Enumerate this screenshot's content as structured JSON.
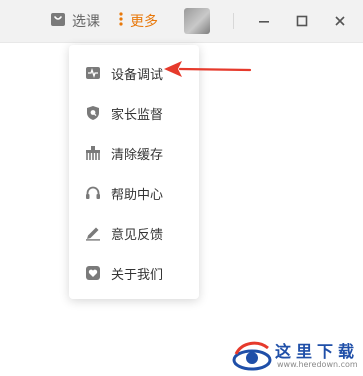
{
  "header": {
    "course_label": "选课",
    "more_label": "更多"
  },
  "menu": {
    "items": [
      {
        "label": "设备调试",
        "icon": "pulse-icon"
      },
      {
        "label": "家长监督",
        "icon": "shield-icon"
      },
      {
        "label": "清除缓存",
        "icon": "broom-icon"
      },
      {
        "label": "帮助中心",
        "icon": "headset-icon"
      },
      {
        "label": "意见反馈",
        "icon": "pencil-icon"
      },
      {
        "label": "关于我们",
        "icon": "heart-badge-icon"
      }
    ]
  },
  "watermark": {
    "name": "这里下载",
    "url": "www.heredown.com"
  },
  "colors": {
    "accent": "#e8780a",
    "icon_gray": "#7a7a7a",
    "arrow_red": "#e63a2c",
    "watermark_blue": "#1f4fa8"
  }
}
